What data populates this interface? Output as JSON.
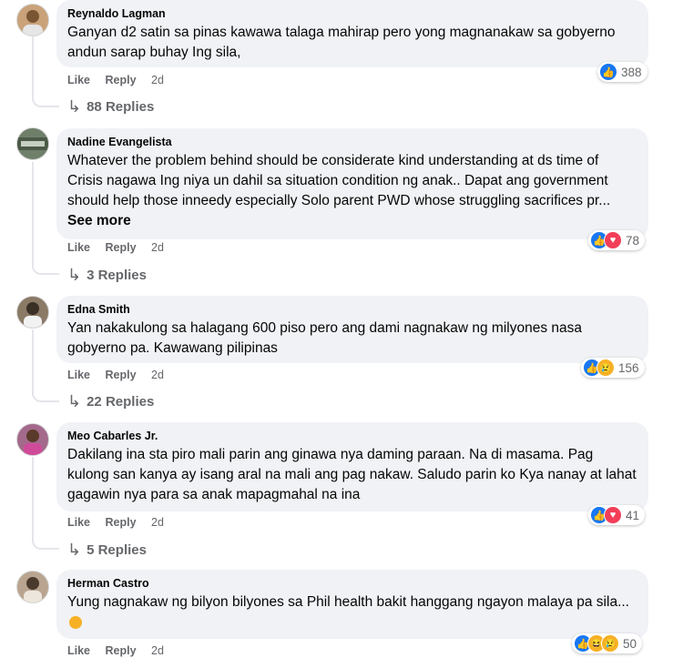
{
  "comments": [
    {
      "author": "Reynaldo Lagman",
      "text": "Ganyan d2 satin sa pinas kawawa talaga mahirap pero yong magnanakaw sa gobyerno andun sarap buhay Ing sila,",
      "like": "Like",
      "reply": "Reply",
      "time": "2d",
      "reaction_count": "388",
      "reaction_types": [
        "like-icon"
      ],
      "replies": "88 Replies",
      "avatar_color": "#c9a27a"
    },
    {
      "author": "Nadine Evangelista",
      "text": "Whatever the problem behind should be considerate kind understanding at ds time of Crisis nagawa Ing niya un dahil sa situation condition ng anak.. Dapat ang government should help those inneedy especially Solo parent PWD whose struggling sacrifices pr...",
      "see_more": "See more",
      "like": "Like",
      "reply": "Reply",
      "time": "2d",
      "reaction_count": "78",
      "reaction_types": [
        "like-icon",
        "love-icon"
      ],
      "replies": "3 Replies",
      "avatar_color": "#6f7f6a"
    },
    {
      "author": "Edna Smith",
      "text": "Yan nakakulong sa halagang 600 piso pero ang dami nagnakaw ng milyones nasa gobyerno pa. Kawawang pilipinas",
      "like": "Like",
      "reply": "Reply",
      "time": "2d",
      "reaction_count": "156",
      "reaction_types": [
        "like-icon",
        "sad-icon"
      ],
      "replies": "22 Replies",
      "avatar_color": "#8a7a66"
    },
    {
      "author": "Meo Cabarles Jr.",
      "text": "Dakilang ina sta piro mali parin ang ginawa nya daming paraan. Na di masama. Pag kulong san kanya ay isang aral na mali ang pag nakaw. Saludo parin ko Kya nanay at lahat gagawin nya para sa anak mapagmahal na ina",
      "like": "Like",
      "reply": "Reply",
      "time": "2d",
      "reaction_count": "41",
      "reaction_types": [
        "like-icon",
        "love-icon"
      ],
      "replies": "5 Replies",
      "avatar_color": "#a36a8c"
    },
    {
      "author": "Herman Castro",
      "text": "Yung nagnakaw ng bilyon bilyones sa Phil health bakit hanggang ngayon malaya pa sila...",
      "like": "Like",
      "reply": "Reply",
      "time": "2d",
      "reaction_count": "50",
      "reaction_types": [
        "like-icon",
        "haha-icon",
        "sad-icon"
      ],
      "avatar_color": "#b9a58f"
    }
  ]
}
